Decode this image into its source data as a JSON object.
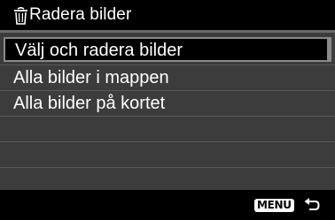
{
  "header": {
    "icon": "trash-icon",
    "title": "Radera bilder"
  },
  "menu": {
    "items": [
      {
        "label": "Välj och radera bilder",
        "selected": true
      },
      {
        "label": "Alla bilder i mappen",
        "selected": false
      },
      {
        "label": "Alla bilder på kortet",
        "selected": false
      }
    ],
    "empty_rows": 3
  },
  "footer": {
    "menu_key_label": "MENU",
    "return_icon": "return-arrow-icon"
  },
  "colors": {
    "background": "#000000",
    "list_background": "#3c3c3c",
    "selection_border": "#8a8a8a",
    "text": "#ffffff"
  }
}
